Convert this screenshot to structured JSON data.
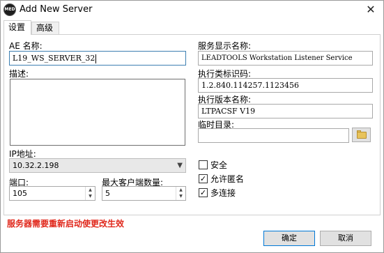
{
  "window": {
    "title": "Add New Server",
    "icon_text": "MED",
    "close_glyph": "✕"
  },
  "tabs": [
    {
      "label": "设置",
      "active": true
    },
    {
      "label": "高级",
      "active": false
    }
  ],
  "left": {
    "ae_title_label": "AE 名称:",
    "ae_title_value": "L19_WS_SERVER_32",
    "description_label": "描述:",
    "description_value": "",
    "ip_label": "IP地址:",
    "ip_value": "10.32.2.198",
    "port_label": "端口:",
    "port_value": "105",
    "max_clients_label": "最大客户端数量:",
    "max_clients_value": "5"
  },
  "right": {
    "display_name_label": "服务显示名称:",
    "display_name_value": "LEADTOOLS Workstation Listener Service",
    "class_uid_label": "执行类标识码:",
    "class_uid_value": "1.2.840.114257.1123456",
    "version_name_label": "执行版本名称:",
    "version_name_value": "LTPACSF V19",
    "temp_dir_label": "临时目录:",
    "temp_dir_value": "",
    "folder_icon": "folder-icon"
  },
  "options": [
    {
      "label": "安全",
      "checked": false
    },
    {
      "label": "允许匿名",
      "checked": true
    },
    {
      "label": "多连接",
      "checked": true
    }
  ],
  "warning": "服务器需要重新启动使更改生效",
  "buttons": {
    "ok": "确定",
    "cancel": "取消"
  },
  "check_glyph": "✓",
  "colors": {
    "warning_text": "#e0281c",
    "focus_border": "#3c7fb1",
    "default_button_border": "#0078d7"
  }
}
